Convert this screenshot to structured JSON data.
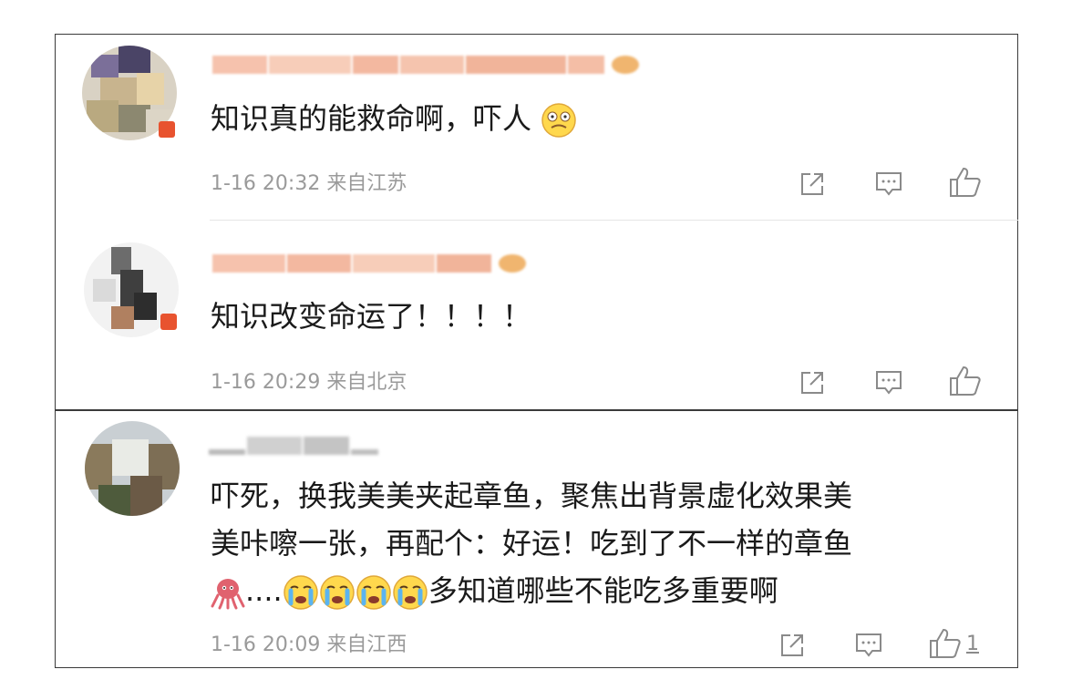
{
  "comments": [
    {
      "text": "知识真的能救命啊，吓人",
      "meta": "1-16 20:32 来自江苏",
      "like_count": ""
    },
    {
      "text": "知识改变命运了！！！！",
      "meta": "1-16 20:29 来自北京",
      "like_count": ""
    },
    {
      "text_line1": "吓死，换我美美夹起章鱼，聚焦出背景虚化效果美",
      "text_line2": "美咔嚓一张，再配个：好运！吃到了不一样的章鱼",
      "text_line3_tail": "多知道哪些不能吃多重要啊",
      "text_line3_dots": "....",
      "meta": "1-16 20:09 来自江西",
      "like_count": "1"
    }
  ],
  "icons": {
    "share": "share-icon",
    "reply": "comment-icon",
    "like": "thumbs-up-icon"
  },
  "colors": {
    "nickname_blur": "#f2b59e",
    "text": "#1a1a1a",
    "meta": "#9a9a9a",
    "icon": "#8a8a8a",
    "badge": "#e8532f"
  }
}
